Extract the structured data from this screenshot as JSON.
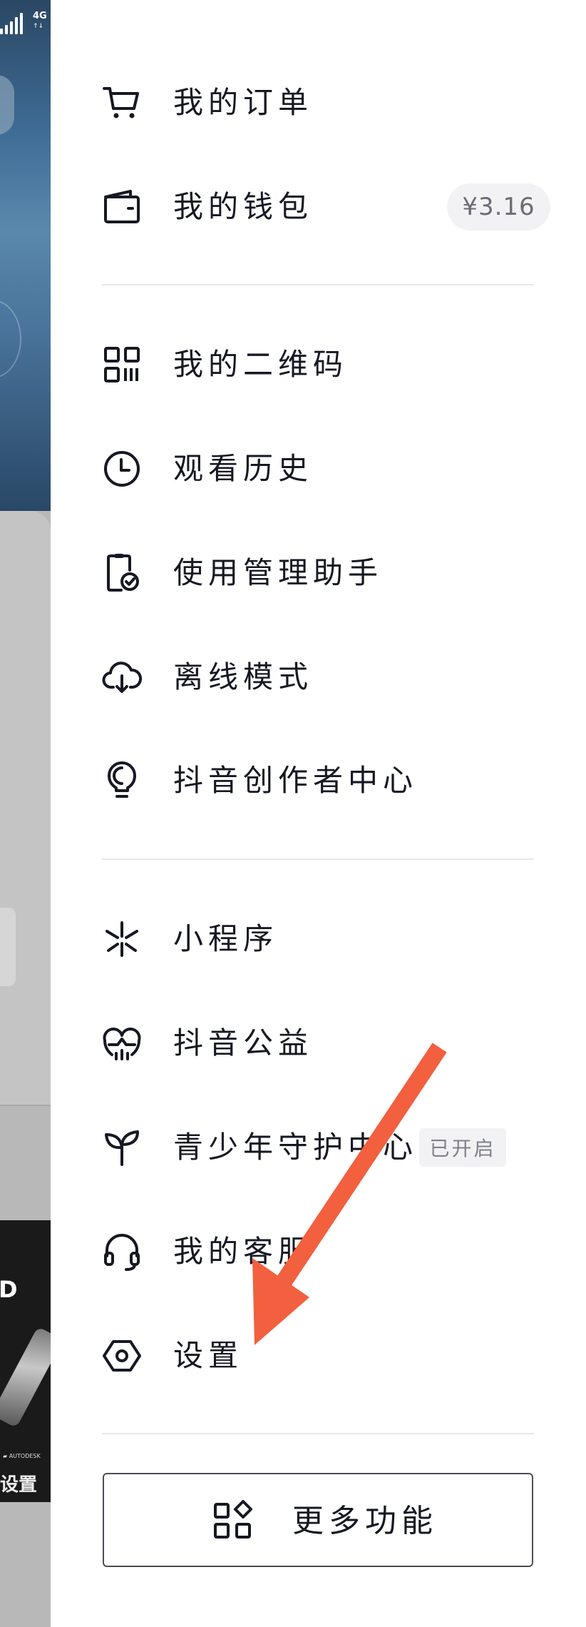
{
  "status_bar": {
    "network": "4G"
  },
  "menu": {
    "orders": {
      "label": "我的订单",
      "icon": "cart-icon"
    },
    "wallet": {
      "label": "我的钱包",
      "icon": "wallet-icon",
      "balance": "¥3.16"
    },
    "qrcode": {
      "label": "我的二维码",
      "icon": "qrcode-icon"
    },
    "history": {
      "label": "观看历史",
      "icon": "clock-icon"
    },
    "usage_assistant": {
      "label": "使用管理助手",
      "icon": "phone-check-icon"
    },
    "offline": {
      "label": "离线模式",
      "icon": "cloud-download-icon"
    },
    "creator_center": {
      "label": "抖音创作者中心",
      "icon": "lightbulb-icon"
    },
    "mini_programs": {
      "label": "小程序",
      "icon": "asterisk-icon"
    },
    "charity": {
      "label": "抖音公益",
      "icon": "heart-chart-icon"
    },
    "youth_protection": {
      "label": "青少年守护中心",
      "icon": "sprout-icon",
      "status": "已开启"
    },
    "customer_service": {
      "label": "我的客服",
      "icon": "headset-icon"
    },
    "settings": {
      "label": "设置",
      "icon": "hexagon-gear-icon"
    }
  },
  "more_functions": {
    "label": "更多功能",
    "icon": "apps-icon"
  },
  "annotation": {
    "color": "#f2603f",
    "target": "settings"
  },
  "colors": {
    "text": "#161823",
    "divider": "#e8e8ea",
    "badge_bg": "#f2f2f4",
    "badge_text": "#6b6c75"
  }
}
